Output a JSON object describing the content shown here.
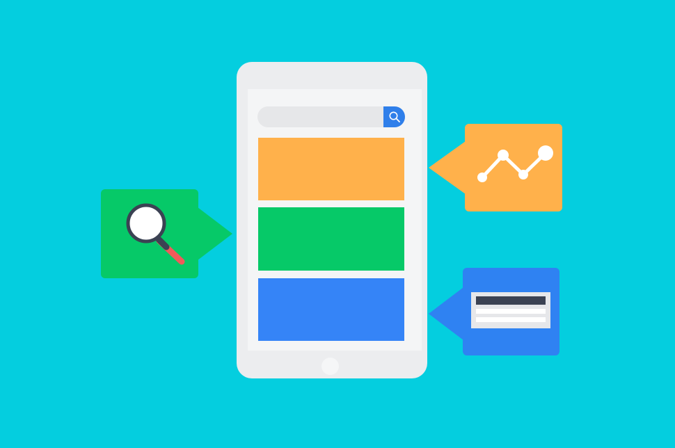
{
  "colors": {
    "background": "#04CEDF",
    "phone_body": "#ECEDEF",
    "phone_screen": "#F4F5F6",
    "search_field": "#E6E7E9",
    "search_button": "#2F7FEA",
    "block_orange": "#FFB14B",
    "block_green": "#06C968",
    "block_blue": "#3584F7",
    "bubble_green": "#06C968",
    "bubble_orange": "#FFB14B",
    "bubble_blue": "#2F82F2",
    "magnifier_handle": "#F05A5A",
    "dark_outline": "#3B4253",
    "white": "#FFFFFF"
  },
  "icons": {
    "search_button": "search-icon",
    "green_bubble": "magnifier-icon",
    "orange_bubble": "line-chart-icon",
    "blue_bubble": "card-lines-icon"
  }
}
